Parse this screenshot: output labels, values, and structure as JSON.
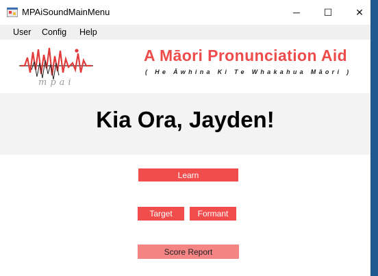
{
  "window": {
    "title": "MPAiSoundMainMenu",
    "controls": {
      "minimize": "─",
      "maximize": "☐",
      "close": "✕"
    }
  },
  "menu": {
    "items": [
      "User",
      "Config",
      "Help"
    ]
  },
  "header": {
    "title": "A Māori Pronunciation Aid",
    "subtitle": "( He Āwhina Ki Te Whakahua Māori )",
    "logo_text": "mpai"
  },
  "greeting": "Kia Ora, Jayden!",
  "buttons": {
    "learn": "Learn",
    "target": "Target",
    "formant": "Formant",
    "score_report": "Score Report"
  },
  "colors": {
    "accent": "#f24d4d",
    "accent_light": "#f58585",
    "title_red": "#ee4b4b"
  }
}
